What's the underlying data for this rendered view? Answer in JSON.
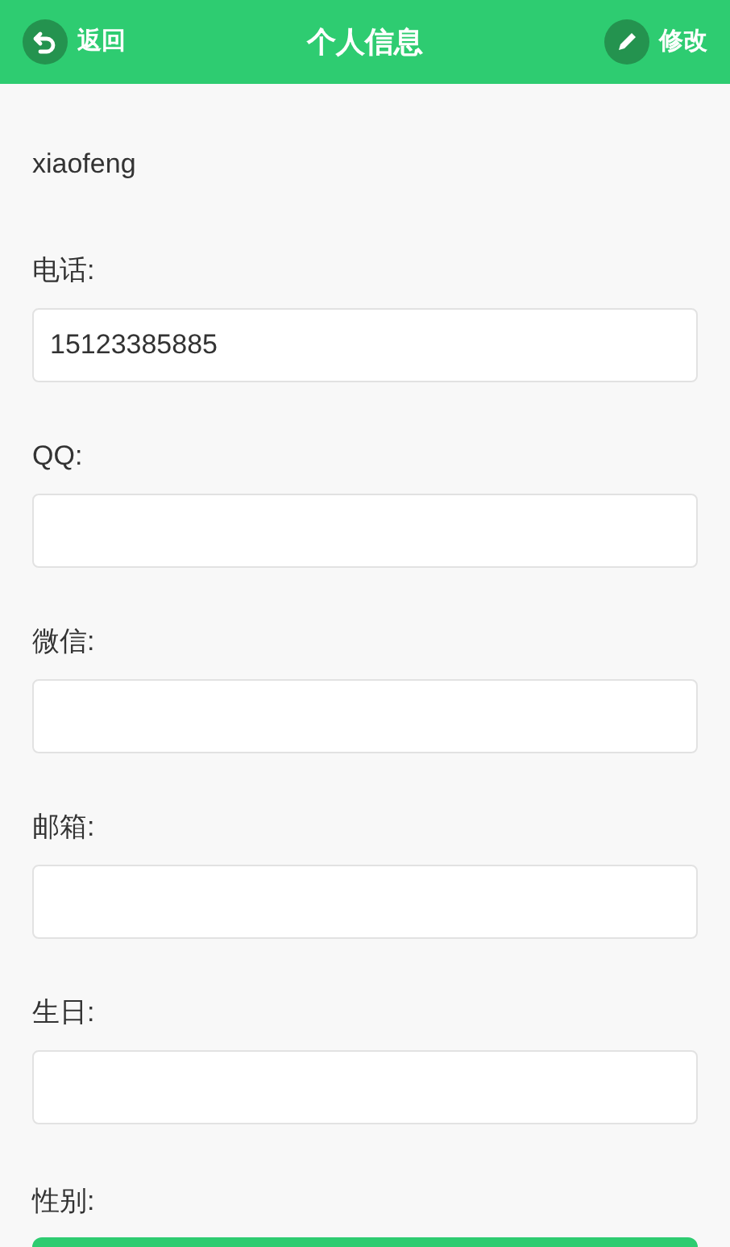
{
  "header": {
    "back": "返回",
    "title": "个人信息",
    "edit": "修改"
  },
  "username": "xiaofeng",
  "fields": [
    {
      "label": "电话:",
      "value": "15123385885"
    },
    {
      "label": "QQ:"
    },
    {
      "label": "微信:"
    },
    {
      "label": "邮箱:"
    },
    {
      "label": "生日:"
    }
  ],
  "gender": {
    "label": "性别:"
  }
}
